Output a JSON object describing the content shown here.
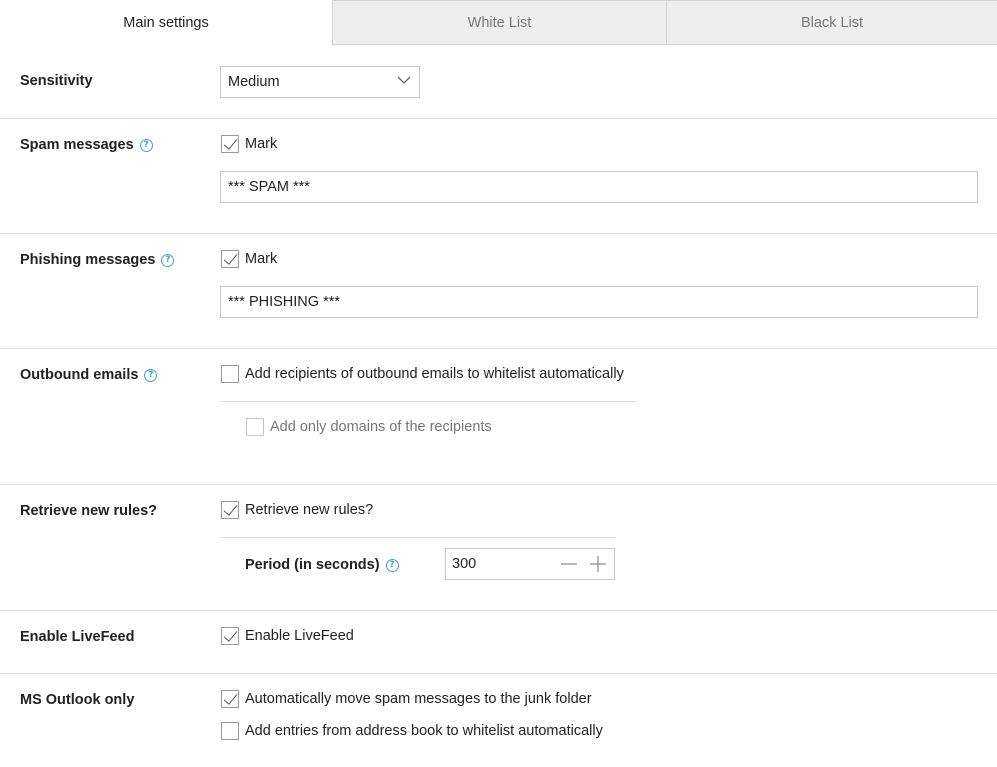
{
  "tabs": [
    {
      "label": "Main settings",
      "active": true
    },
    {
      "label": "White List",
      "active": false
    },
    {
      "label": "Black List",
      "active": false
    }
  ],
  "sensitivity": {
    "label": "Sensitivity",
    "selected": "Medium"
  },
  "spam": {
    "label": "Spam messages",
    "help_icon": "help-icon",
    "mark_label": "Mark",
    "mark_checked": true,
    "tag_value": "*** SPAM ***"
  },
  "phishing": {
    "label": "Phishing messages",
    "help_icon": "help-icon",
    "mark_label": "Mark",
    "mark_checked": true,
    "tag_value": "*** PHISHING ***"
  },
  "outbound": {
    "label": "Outbound emails",
    "help_icon": "help-icon",
    "add_recipients_label": "Add recipients of outbound emails to whitelist automatically",
    "add_recipients_checked": false,
    "domains_only_label": "Add only domains of the recipients",
    "domains_only_checked": false,
    "domains_only_disabled": true
  },
  "rules": {
    "label": "Retrieve new rules?",
    "checkbox_label": "Retrieve new rules?",
    "checked": true,
    "period_label": "Period (in seconds)",
    "period_value": "300"
  },
  "livefeed": {
    "label": "Enable LiveFeed",
    "checkbox_label": "Enable LiveFeed",
    "checked": true
  },
  "outlook": {
    "label": "MS Outlook only",
    "move_spam_label": "Automatically move spam messages to the junk folder",
    "move_spam_checked": true,
    "address_book_label": "Add entries from address book to whitelist automatically",
    "address_book_checked": false
  },
  "colors": {
    "help_icon": "#3aa7c4",
    "tab_inactive_bg": "#eeeeee",
    "border": "#d2d2d2"
  }
}
